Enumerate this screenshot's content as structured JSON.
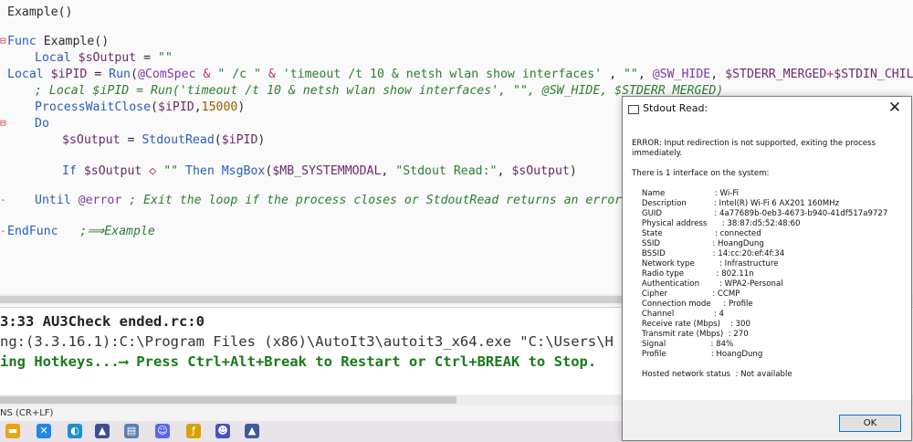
{
  "editor": {
    "lines": [
      {
        "gutter": "",
        "indent": 8,
        "tokens": [
          {
            "c": "dflt",
            "t": "Example()"
          }
        ]
      },
      {
        "gutter": "⊟",
        "indent": 8,
        "tokens": [
          {
            "c": "kw",
            "t": "Func "
          },
          {
            "c": "dflt",
            "t": "Example()"
          }
        ]
      },
      {
        "gutter": "",
        "indent": 38,
        "tokens": [
          {
            "c": "kw",
            "t": "Local "
          },
          {
            "c": "var",
            "t": "$sOutput"
          },
          {
            "c": "dflt",
            "t": " = "
          },
          {
            "c": "str",
            "t": "\"\""
          }
        ]
      },
      {
        "gutter": "",
        "indent": 8,
        "tokens": [
          {
            "c": "kw",
            "t": "Local "
          },
          {
            "c": "var",
            "t": "$iPID"
          },
          {
            "c": "dflt",
            "t": " = "
          },
          {
            "c": "fn",
            "t": "Run"
          },
          {
            "c": "dflt",
            "t": "("
          },
          {
            "c": "mac",
            "t": "@ComSpec"
          },
          {
            "c": "op",
            "t": " & "
          },
          {
            "c": "str",
            "t": "\" /c \""
          },
          {
            "c": "op",
            "t": " & "
          },
          {
            "c": "str",
            "t": "'timeout /t 10 & netsh wlan show interfaces'"
          },
          {
            "c": "dflt",
            "t": " , "
          },
          {
            "c": "str",
            "t": "\"\""
          },
          {
            "c": "dflt",
            "t": ", "
          },
          {
            "c": "mac",
            "t": "@SW_HIDE"
          },
          {
            "c": "dflt",
            "t": ", "
          },
          {
            "c": "var",
            "t": "$STDERR_MERGED"
          },
          {
            "c": "op",
            "t": "+"
          },
          {
            "c": "var",
            "t": "$STDIN_CHILD"
          },
          {
            "c": "dflt",
            "t": ")"
          }
        ]
      },
      {
        "gutter": "",
        "indent": 38,
        "tokens": [
          {
            "c": "cm",
            "t": "; Local $iPID = Run('timeout /t 10 & netsh wlan show interfaces', \"\", @SW_HIDE, $STDERR_MERGED)"
          }
        ]
      },
      {
        "gutter": "",
        "indent": 38,
        "tokens": [
          {
            "c": "fn",
            "t": "ProcessWaitClose"
          },
          {
            "c": "dflt",
            "t": "("
          },
          {
            "c": "var",
            "t": "$iPID"
          },
          {
            "c": "dflt",
            "t": ","
          },
          {
            "c": "num",
            "t": "15000"
          },
          {
            "c": "dflt",
            "t": ")"
          }
        ]
      },
      {
        "gutter": "⊟",
        "indent": 38,
        "tokens": [
          {
            "c": "kw",
            "t": "Do"
          }
        ]
      },
      {
        "gutter": "",
        "indent": 68,
        "tokens": [
          {
            "c": "var",
            "t": "$sOutput"
          },
          {
            "c": "dflt",
            "t": " = "
          },
          {
            "c": "fn",
            "t": "StdoutRead"
          },
          {
            "c": "dflt",
            "t": "("
          },
          {
            "c": "var",
            "t": "$iPID"
          },
          {
            "c": "dflt",
            "t": ")"
          }
        ]
      },
      {
        "gutter": "",
        "indent": 68,
        "tokens": []
      },
      {
        "gutter": "",
        "indent": 68,
        "tokens": [
          {
            "c": "kw",
            "t": "If "
          },
          {
            "c": "var",
            "t": "$sOutput"
          },
          {
            "c": "op",
            "t": " ◇ "
          },
          {
            "c": "str",
            "t": "\"\""
          },
          {
            "c": "kw",
            "t": " Then "
          },
          {
            "c": "fn",
            "t": "MsgBox"
          },
          {
            "c": "dflt",
            "t": "("
          },
          {
            "c": "var",
            "t": "$MB_SYSTEMMODAL"
          },
          {
            "c": "dflt",
            "t": ", "
          },
          {
            "c": "str",
            "t": "\"Stdout Read:\""
          },
          {
            "c": "dflt",
            "t": ", "
          },
          {
            "c": "var",
            "t": "$sOutput"
          },
          {
            "c": "dflt",
            "t": ")"
          }
        ]
      },
      {
        "gutter": "",
        "indent": 68,
        "tokens": []
      },
      {
        "gutter": "-",
        "indent": 38,
        "tokens": [
          {
            "c": "kw",
            "t": "Until "
          },
          {
            "c": "mac",
            "t": "@error"
          },
          {
            "c": "cm",
            "t": " ; Exit the loop if the process closes or StdoutRead returns an error."
          }
        ]
      },
      {
        "gutter": "",
        "indent": 68,
        "tokens": []
      },
      {
        "gutter": "-",
        "indent": 8,
        "tokens": [
          {
            "c": "kw",
            "t": "EndFunc"
          },
          {
            "c": "cm",
            "t": "   ;⟹Example"
          }
        ]
      }
    ]
  },
  "console": {
    "line1": "3:33 AU3Check ended.rc:0",
    "line2": "ng:(3.3.16.1):C:\\Program Files (x86)\\AutoIt3\\autoit3_x64.exe \"C:\\Users\\H",
    "line3": "ing Hotkeys...⟶ Press Ctrl+Alt+Break to Restart or Ctrl+BREAK to Stop."
  },
  "statusbar": {
    "text": "NS (CR+LF)"
  },
  "taskbar": {
    "icons": [
      {
        "name": "file-explorer-icon",
        "glyph": "▬",
        "color": "#e8a317"
      },
      {
        "name": "vscode-icon",
        "glyph": "✕",
        "color": "#1e88e5"
      },
      {
        "name": "edge-icon",
        "glyph": "◐",
        "color": "#1b8fd2"
      },
      {
        "name": "autoit-icon",
        "glyph": "▲",
        "color": "#3d4f8f"
      },
      {
        "name": "window-app-icon",
        "glyph": "▤",
        "color": "#5c7fb0"
      },
      {
        "name": "discord-icon",
        "glyph": "☺",
        "color": "#5865f2"
      },
      {
        "name": "script-icon",
        "glyph": "ƒ",
        "color": "#d6a300"
      },
      {
        "name": "discord-alt-icon",
        "glyph": "☻",
        "color": "#4752c4"
      },
      {
        "name": "autoit-alt-icon",
        "glyph": "▲",
        "color": "#3d5a9f"
      }
    ]
  },
  "dialog": {
    "title": "Stdout Read:",
    "close_glyph": "✕",
    "messages": [
      "ERROR: Input redirection is not supported, exiting the process",
      "immediately.",
      "",
      "There is 1 interface on the system:",
      "",
      "    Name                    : Wi-Fi",
      "    Description           : Intel(R) Wi-Fi 6 AX201 160MHz",
      "    GUID                     : 4a77689b-0eb3-4673-b940-41df517a9727",
      "    Physical address      : 38:87:d5:52:48:60",
      "    State                     : connected",
      "    SSID                     : HoangDung",
      "    BSSID                   : 14:cc:20:ef:4f:34",
      "    Network type          : Infrastructure",
      "    Radio type             : 802.11n",
      "    Authentication        : WPA2-Personal",
      "    Cipher                  : CCMP",
      "    Connection mode     : Profile",
      "    Channel                : 4",
      "    Receive rate (Mbps)    : 300",
      "    Transmit rate (Mbps)  : 270",
      "    Signal                  : 84%",
      "    Profile                  : HoangDung",
      "",
      "    Hosted network status  : Not available"
    ],
    "ok_label": "OK"
  }
}
